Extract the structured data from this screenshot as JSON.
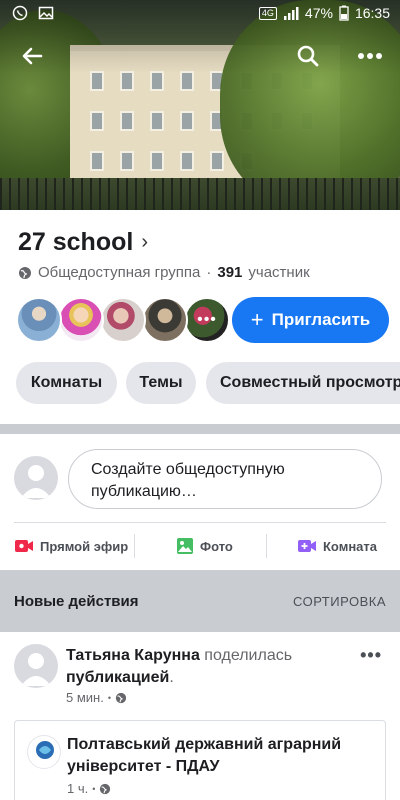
{
  "status_bar": {
    "battery": "47%",
    "time": "16:35",
    "network": "4G"
  },
  "nav": {
    "back_icon": "back-arrow-icon",
    "search_icon": "search-icon",
    "more_icon": "more-icon"
  },
  "group": {
    "name": "27 school",
    "privacy": "Общедоступная группа",
    "separator": "·",
    "members_count": "391",
    "members_label": "участник",
    "more_members_label": "•••"
  },
  "invite_button": {
    "label": "Пригласить",
    "icon": "+"
  },
  "chips": [
    "Комнаты",
    "Темы",
    "Совместный просмотр"
  ],
  "composer": {
    "placeholder": "Создайте общедоступную публикацию…"
  },
  "actions": [
    {
      "label": "Прямой эфир",
      "icon": "live-video-icon",
      "color": "#f02849"
    },
    {
      "label": "Фото",
      "icon": "photo-icon",
      "color": "#45bd62"
    },
    {
      "label": "Комната",
      "icon": "room-video-icon",
      "color": "#9360f7"
    }
  ],
  "feed": {
    "title": "Новые действия",
    "sort_label": "СОРТИРОВКА"
  },
  "post": {
    "author": "Татьяна Карунна",
    "action_text": "поделилась",
    "object": "публикацией",
    "period": ".",
    "time": "5 мин.",
    "dot": "•",
    "more": "•••",
    "shared": {
      "name": "Полтавський державний аграрний університет - ПДАУ",
      "time": "1 ч.",
      "dot": "•"
    }
  },
  "colors": {
    "accent": "#1877f2",
    "chip_bg": "#e4e6eb",
    "section_bg": "#c9ccd1"
  }
}
